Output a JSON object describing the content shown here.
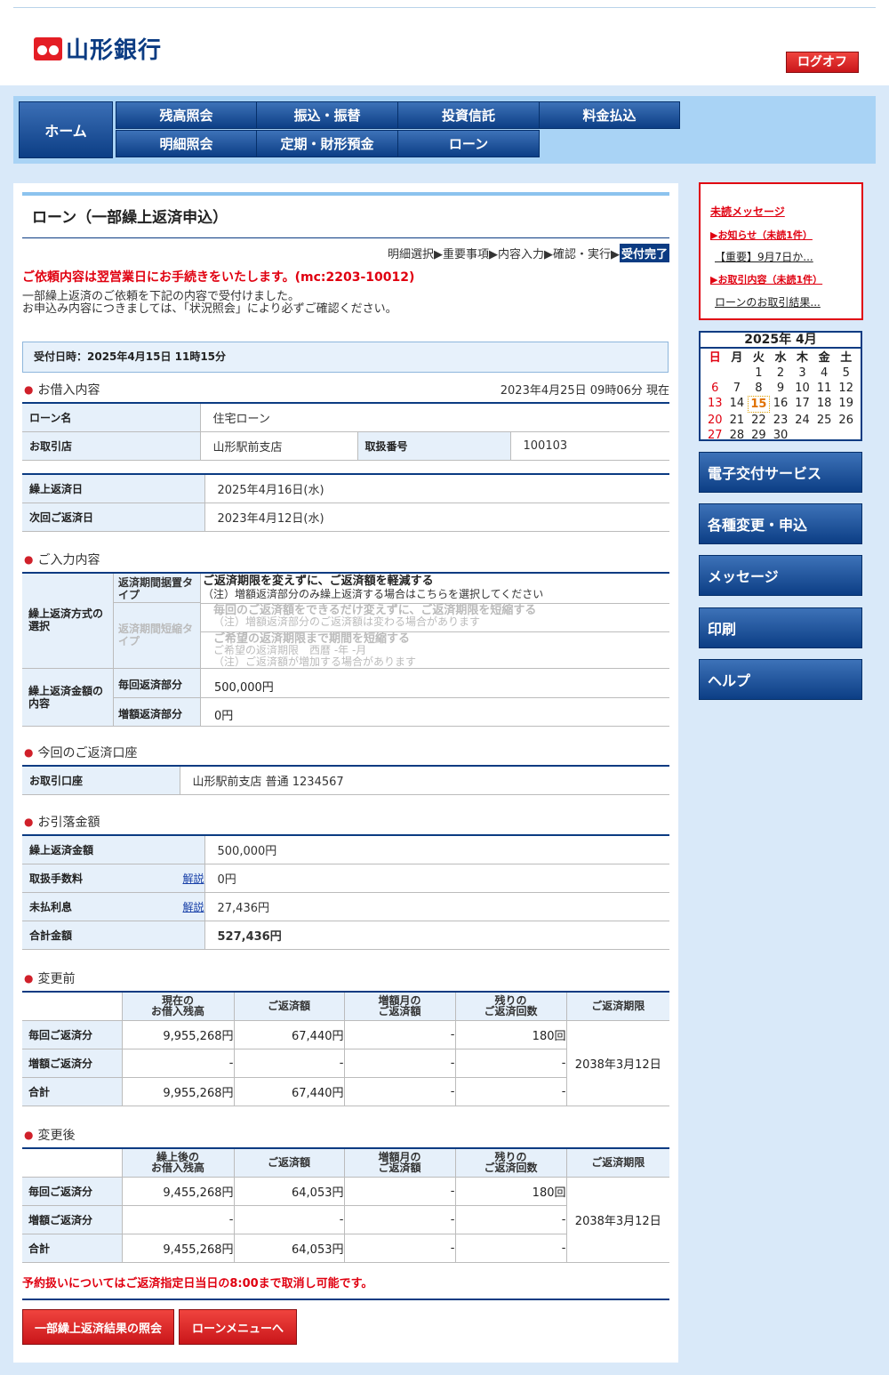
{
  "header": {
    "bank_name": "山形銀行",
    "logoff": "ログオフ"
  },
  "nav": {
    "home": "ホーム",
    "items": [
      "残高照会",
      "振込・振替",
      "投資信託",
      "料金払込",
      "明細照会",
      "定期・財形預金",
      "ローン"
    ]
  },
  "page": {
    "title": "ローン（一部繰上返済申込）",
    "steps": {
      "prefix": "明細選択▶重要事項▶内容入力▶確認・実行▶",
      "current": "受付完了"
    },
    "notice_red": "ご依頼内容は翌営業日にお手続きをいたします。(mc:2203-10012)",
    "notice_line1": "一部繰上返済のご依頼を下記の内容で受付けました。",
    "notice_line2": "お申込み内容につきましては、「状況照会」により必ずご確認ください。",
    "received": "受付日時：2025年4月15日 11時15分"
  },
  "loan": {
    "heading": "お借入内容",
    "as_of": "2023年4月25日 09時06分 現在",
    "name_label": "ローン名",
    "name": "住宅ローン",
    "branch_label": "お取引店",
    "branch": "山形駅前支店",
    "num_label": "取扱番号",
    "num": "100103",
    "prepay_date_label": "繰上返済日",
    "prepay_date": "2025年4月16日(水)",
    "next_date_label": "次回ご返済日",
    "next_date": "2023年4月12日(水)"
  },
  "input": {
    "heading": "ご入力内容",
    "method_label": "繰上返済方式の選択",
    "type1_label": "返済期間据置タイプ",
    "type1_main": "ご返済期限を変えずに、ご返済額を軽減する",
    "type1_note": "（注）増額返済部分のみ繰上返済する場合はこちらを選択してください",
    "type2_label": "返済期間短縮タイプ",
    "type2a_main": "毎回のご返済額をできるだけ変えずに、ご返済期限を短縮する",
    "type2a_note": "（注）増額返済部分のご返済額は変わる場合があります",
    "type2b_main": "ご希望の返済期限まで期間を短縮する",
    "type2b_sub": "ご希望の返済期限　西暦 -年 -月",
    "type2b_note": "（注）ご返済額が増加する場合があります",
    "amount_label": "繰上返済金額の内容",
    "each_label": "毎回返済部分",
    "each": "500,000円",
    "bonus_label": "増額返済部分",
    "bonus": "0円"
  },
  "account": {
    "heading": "今回のご返済口座",
    "label": "お取引口座",
    "value": "山形駅前支店 普通 1234567"
  },
  "debit": {
    "heading": "お引落金額",
    "amount_label": "繰上返済金額",
    "amount": "500,000円",
    "fee_label": "取扱手数料",
    "fee": "0円",
    "link": "解説",
    "interest_label": "未払利息",
    "interest": "27,436円",
    "total_label": "合計金額",
    "total": "527,436円"
  },
  "before": {
    "heading": "変更前",
    "cols": [
      "現在の\nお借入残高",
      "ご返済額",
      "増額月の\nご返済額",
      "残りの\nご返済回数",
      "ご返済期限"
    ],
    "rows": [
      {
        "label": "毎回ご返済分",
        "bal": "9,955,268円",
        "pay": "67,440円",
        "bonus": "-",
        "count": "180回"
      },
      {
        "label": "増額ご返済分",
        "bal": "-",
        "pay": "-",
        "bonus": "-",
        "count": "-"
      },
      {
        "label": "合計",
        "bal": "9,955,268円",
        "pay": "67,440円",
        "bonus": "-",
        "count": "-"
      }
    ],
    "period": "2038年3月12日"
  },
  "after": {
    "heading": "変更後",
    "cols": [
      "繰上後の\nお借入残高",
      "ご返済額",
      "増額月の\nご返済額",
      "残りの\nご返済回数",
      "ご返済期限"
    ],
    "rows": [
      {
        "label": "毎回ご返済分",
        "bal": "9,455,268円",
        "pay": "64,053円",
        "bonus": "-",
        "count": "180回"
      },
      {
        "label": "増額ご返済分",
        "bal": "-",
        "pay": "-",
        "bonus": "-",
        "count": "-"
      },
      {
        "label": "合計",
        "bal": "9,455,268円",
        "pay": "64,053円",
        "bonus": "-",
        "count": "-"
      }
    ],
    "period": "2038年3月12日"
  },
  "footer": {
    "note": "予約扱いについてはご返済指定日当日の8:00まで取消し可能です。",
    "btn_result": "一部繰上返済結果の照会",
    "btn_menu": "ローンメニューへ"
  },
  "side": {
    "msg_title": "未読メッセージ",
    "notice_title": "▶お知らせ（未読1件）",
    "notice_item": "【重要】9月7日か...",
    "deal_title": "▶お取引内容（未読1件）",
    "deal_item": "ローンのお取引結果...",
    "cal_title": "2025年 4月",
    "weekdays": [
      "日",
      "月",
      "火",
      "水",
      "木",
      "金",
      "土"
    ],
    "days": [
      "",
      "",
      "1",
      "2",
      "3",
      "4",
      "5",
      "6",
      "7",
      "8",
      "9",
      "10",
      "11",
      "12",
      "13",
      "14",
      "15",
      "16",
      "17",
      "18",
      "19",
      "20",
      "21",
      "22",
      "23",
      "24",
      "25",
      "26",
      "27",
      "28",
      "29",
      "30",
      "",
      "",
      ""
    ],
    "today": "15",
    "buttons": [
      "電子交付サービス",
      "各種変更・申込",
      "メッセージ",
      "印刷",
      "ヘルプ"
    ]
  }
}
